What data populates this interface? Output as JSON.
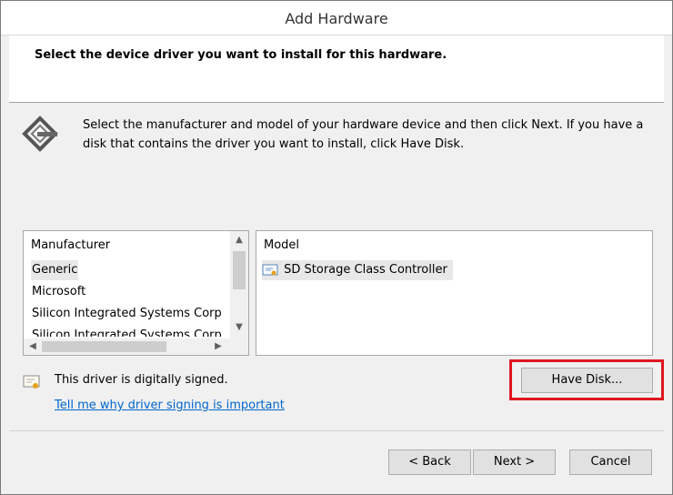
{
  "window": {
    "title": "Add Hardware"
  },
  "header": {
    "heading": "Select the device driver you want to install for this hardware."
  },
  "instruction": "Select the manufacturer and model of your hardware device and then click Next. If you have a disk that contains the driver you want to install, click Have Disk.",
  "manufacturer_list": {
    "header": "Manufacturer",
    "items": [
      "Generic",
      "Microsoft",
      "Silicon Integrated Systems Corp",
      "Silicon Integrated Systems Corp"
    ],
    "selected": "Generic"
  },
  "model_list": {
    "header": "Model",
    "items": [
      "SD Storage Class Controller"
    ],
    "selected": "SD Storage Class Controller"
  },
  "signing": {
    "status": "This driver is digitally signed.",
    "link": "Tell me why driver signing is important"
  },
  "buttons": {
    "have_disk": "Have Disk...",
    "back": "< Back",
    "next": "Next >",
    "cancel": "Cancel"
  },
  "colors": {
    "highlight": "#e0161f",
    "link": "#0066cc",
    "dialog_bg": "#f0f0f0"
  }
}
